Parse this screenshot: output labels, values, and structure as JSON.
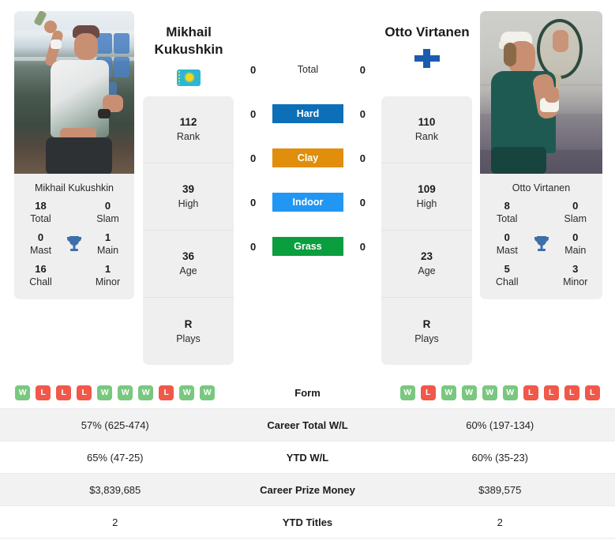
{
  "players": {
    "left": {
      "first_name": "Mikhail",
      "last_name": "Kukushkin",
      "full_name": "Mikhail Kukushkin",
      "country_flag": "kazakhstan-flag",
      "photo_alt": "mikhail-kukushkin-serving",
      "stats": [
        {
          "value": "112",
          "label": "Rank"
        },
        {
          "value": "39",
          "label": "High"
        },
        {
          "value": "36",
          "label": "Age"
        },
        {
          "value": "R",
          "label": "Plays"
        }
      ],
      "titles": [
        {
          "value": "18",
          "label": "Total"
        },
        {
          "value": "0",
          "label": "Slam"
        },
        {
          "value": "0",
          "label": "Mast"
        },
        {
          "value": "1",
          "label": "Main"
        },
        {
          "value": "16",
          "label": "Chall"
        },
        {
          "value": "1",
          "label": "Minor"
        }
      ],
      "form": [
        "W",
        "L",
        "L",
        "L",
        "W",
        "W",
        "W",
        "L",
        "W",
        "W"
      ],
      "career_total_wl": "57% (625-474)",
      "ytd_wl": "65% (47-25)",
      "career_prize_money": "$3,839,685",
      "ytd_titles": "2"
    },
    "right": {
      "first_name": "Otto",
      "last_name": "Virtanen",
      "full_name": "Otto Virtanen",
      "country_flag": "finland-flag",
      "photo_alt": "otto-virtanen-with-racquet",
      "stats": [
        {
          "value": "110",
          "label": "Rank"
        },
        {
          "value": "109",
          "label": "High"
        },
        {
          "value": "23",
          "label": "Age"
        },
        {
          "value": "R",
          "label": "Plays"
        }
      ],
      "titles": [
        {
          "value": "8",
          "label": "Total"
        },
        {
          "value": "0",
          "label": "Slam"
        },
        {
          "value": "0",
          "label": "Mast"
        },
        {
          "value": "0",
          "label": "Main"
        },
        {
          "value": "5",
          "label": "Chall"
        },
        {
          "value": "3",
          "label": "Minor"
        }
      ],
      "form": [
        "W",
        "L",
        "W",
        "W",
        "W",
        "W",
        "L",
        "L",
        "L",
        "L"
      ],
      "career_total_wl": "60% (197-134)",
      "ytd_wl": "60% (35-23)",
      "career_prize_money": "$389,575",
      "ytd_titles": "2"
    }
  },
  "head_to_head": [
    {
      "surface": "Total",
      "left_score": "0",
      "right_score": "0",
      "badge": false,
      "color": ""
    },
    {
      "surface": "Hard",
      "left_score": "0",
      "right_score": "0",
      "badge": true,
      "color": "#0d6fb8"
    },
    {
      "surface": "Clay",
      "left_score": "0",
      "right_score": "0",
      "badge": true,
      "color": "#e08e0b"
    },
    {
      "surface": "Indoor",
      "left_score": "0",
      "right_score": "0",
      "badge": true,
      "color": "#2196f3"
    },
    {
      "surface": "Grass",
      "left_score": "0",
      "right_score": "0",
      "badge": true,
      "color": "#0a9e3f"
    }
  ],
  "comparison_rows": [
    {
      "label": "Form",
      "type": "form",
      "left": "",
      "right": ""
    },
    {
      "label": "Career Total W/L",
      "type": "text",
      "left": "57% (625-474)",
      "right": "60% (197-134)"
    },
    {
      "label": "YTD W/L",
      "type": "text",
      "left": "65% (47-25)",
      "right": "60% (35-23)"
    },
    {
      "label": "Career Prize Money",
      "type": "text",
      "left": "$3,839,685",
      "right": "$389,575"
    },
    {
      "label": "YTD Titles",
      "type": "text",
      "left": "2",
      "right": "2"
    }
  ],
  "colors": {
    "win_badge": "#7ac77f",
    "loss_badge": "#f0584a",
    "trophy": "#3d6fa8",
    "card_bg": "#efefef",
    "row_alt_bg": "#f2f2f2"
  }
}
